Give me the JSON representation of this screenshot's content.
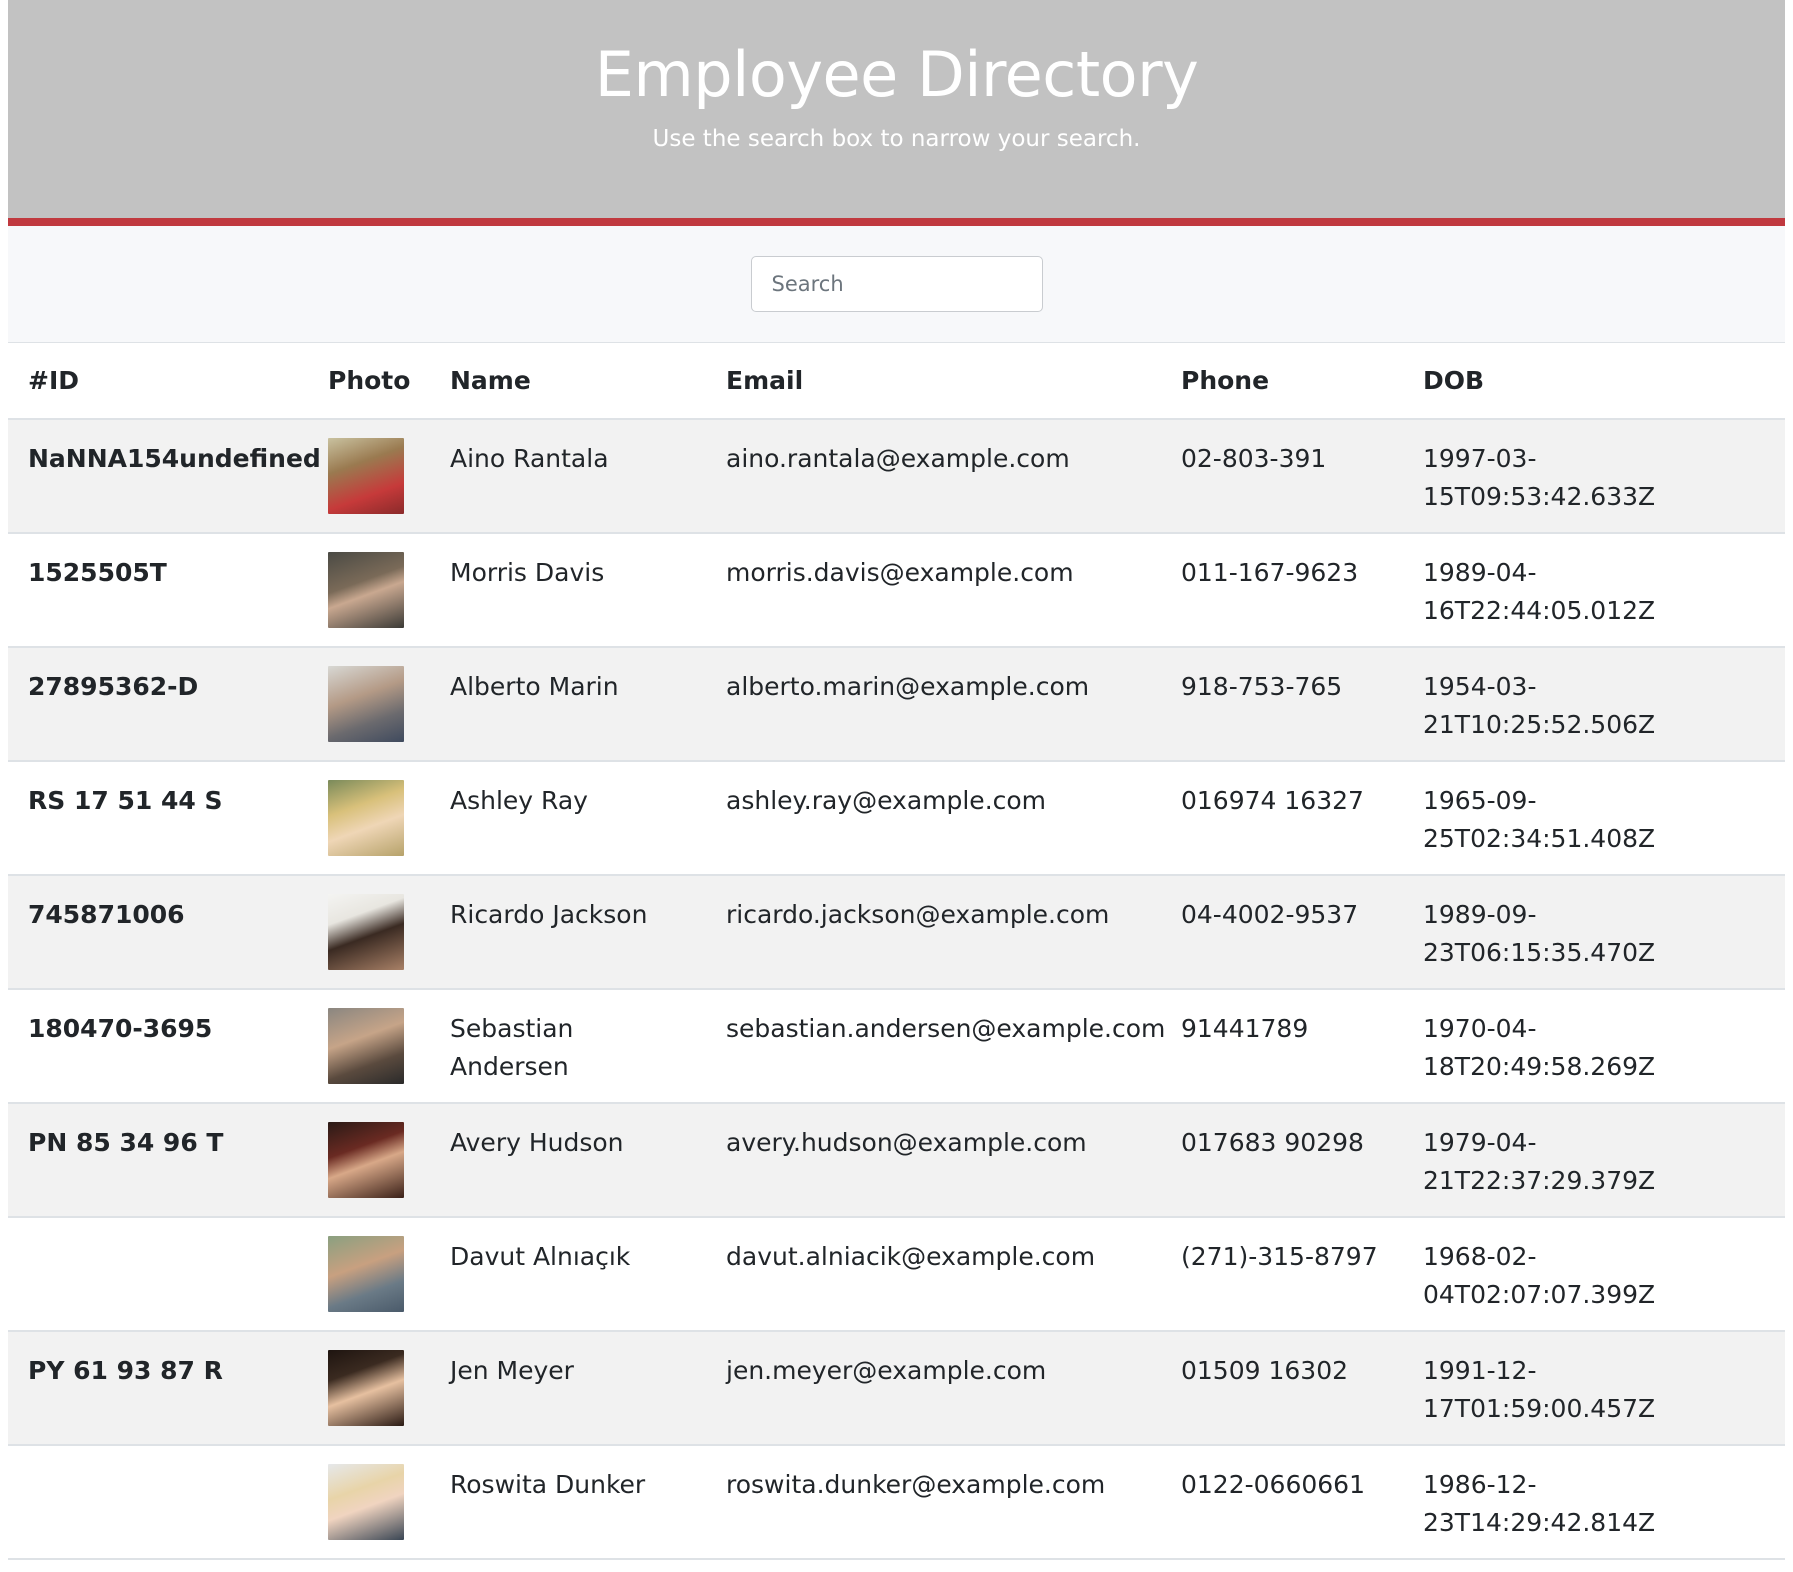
{
  "header": {
    "title": "Employee Directory",
    "subtitle": "Use the search box to narrow your search."
  },
  "search": {
    "placeholder": "Search",
    "value": ""
  },
  "table": {
    "columns": [
      "#ID",
      "Photo",
      "Name",
      "Email",
      "Phone",
      "DOB"
    ],
    "rows": [
      {
        "id": "NaNNA154undefined",
        "name": "Aino Rantala",
        "email": "aino.rantala@example.com",
        "phone": "02-803-391",
        "dob": "1997-03-15T09:53:42.633Z"
      },
      {
        "id": "1525505T",
        "name": "Morris Davis",
        "email": "morris.davis@example.com",
        "phone": "011-167-9623",
        "dob": "1989-04-16T22:44:05.012Z"
      },
      {
        "id": "27895362-D",
        "name": "Alberto Marin",
        "email": "alberto.marin@example.com",
        "phone": "918-753-765",
        "dob": "1954-03-21T10:25:52.506Z"
      },
      {
        "id": "RS 17 51 44 S",
        "name": "Ashley Ray",
        "email": "ashley.ray@example.com",
        "phone": "016974 16327",
        "dob": "1965-09-25T02:34:51.408Z"
      },
      {
        "id": "745871006",
        "name": "Ricardo Jackson",
        "email": "ricardo.jackson@example.com",
        "phone": "04-4002-9537",
        "dob": "1989-09-23T06:15:35.470Z"
      },
      {
        "id": "180470-3695",
        "name": "Sebastian Andersen",
        "email": "sebastian.andersen@example.com",
        "phone": "91441789",
        "dob": "1970-04-18T20:49:58.269Z"
      },
      {
        "id": "PN 85 34 96 T",
        "name": "Avery Hudson",
        "email": "avery.hudson@example.com",
        "phone": "017683 90298",
        "dob": "1979-04-21T22:37:29.379Z"
      },
      {
        "id": "",
        "name": "Davut Alnıaçık",
        "email": "davut.alniacik@example.com",
        "phone": "(271)-315-8797",
        "dob": "1968-02-04T02:07:07.399Z"
      },
      {
        "id": "PY 61 93 87 R",
        "name": "Jen Meyer",
        "email": "jen.meyer@example.com",
        "phone": "01509 16302",
        "dob": "1991-12-17T01:59:00.457Z"
      },
      {
        "id": "",
        "name": "Roswita Dunker",
        "email": "roswita.dunker@example.com",
        "phone": "0122-0660661",
        "dob": "1986-12-23T14:29:42.814Z"
      }
    ]
  },
  "colors": {
    "header_bg": "#c2c2c2",
    "header_accent": "#c0393f",
    "search_bar_bg": "#f7f8fa",
    "stripe": "#f2f2f2"
  }
}
